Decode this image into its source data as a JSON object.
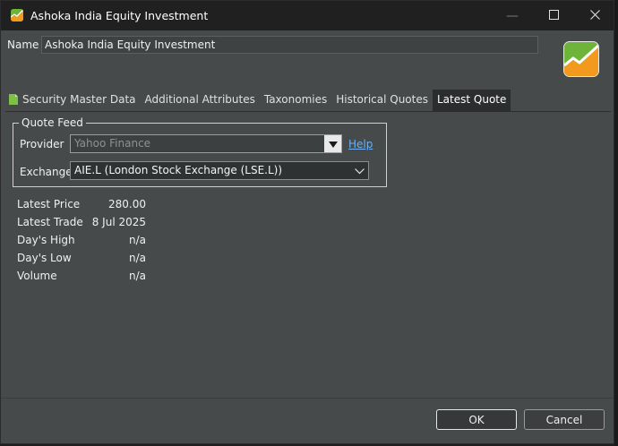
{
  "window": {
    "title": "Ashoka India Equity Investment",
    "minimize_glyph": "—",
    "maximize_glyph": "☐",
    "close_glyph": "✕"
  },
  "name_field": {
    "label": "Name",
    "value": "Ashoka India Equity Investment"
  },
  "tabs": [
    {
      "label": "Security Master Data",
      "icon": "document-icon",
      "active": false
    },
    {
      "label": "Additional Attributes",
      "active": false
    },
    {
      "label": "Taxonomies",
      "active": false
    },
    {
      "label": "Historical Quotes",
      "active": false
    },
    {
      "label": "Latest Quote",
      "active": true
    }
  ],
  "quote_feed": {
    "legend": "Quote Feed",
    "provider_label": "Provider",
    "provider_value": "Yahoo Finance",
    "help_link": "Help",
    "exchange_label": "Exchange",
    "exchange_value": "AIE.L (London Stock Exchange (LSE.L))"
  },
  "latest_quote": [
    {
      "label": "Latest Price",
      "value": "280.00"
    },
    {
      "label": "Latest Trade",
      "value": "8 Jul 2025"
    },
    {
      "label": "Day's High",
      "value": "n/a"
    },
    {
      "label": "Day's Low",
      "value": "n/a"
    },
    {
      "label": "Volume",
      "value": "n/a"
    }
  ],
  "buttons": {
    "ok": "OK",
    "cancel": "Cancel"
  },
  "colors": {
    "accent_link": "#6cb0f0",
    "logo_green": "#6fb43a",
    "logo_orange": "#f39a1e",
    "active_tab": "#2b2d2e"
  }
}
